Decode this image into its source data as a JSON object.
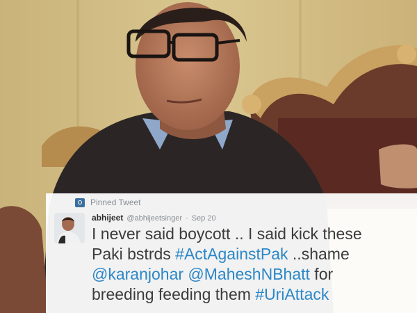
{
  "tweet": {
    "pinned_label": "Pinned Tweet",
    "pin_icon": "pin-icon",
    "display_name": "abhijeet",
    "handle": "@abhijeetsinger",
    "separator": "·",
    "date": "Sep 20",
    "lines": [
      [
        {
          "t": "I never said boycott .. I said kick these",
          "link": false
        }
      ],
      [
        {
          "t": "Paki bstrds ",
          "link": false
        },
        {
          "t": "#ActAgainstPak",
          "link": true
        },
        {
          "t": " ..shame",
          "link": false
        }
      ],
      [
        {
          "t": "@karanjohar",
          "link": true
        },
        {
          "t": " ",
          "link": false
        },
        {
          "t": "@MaheshNBhatt",
          "link": true
        },
        {
          "t": " for",
          "link": false
        }
      ],
      [
        {
          "t": "breeding feeding them ",
          "link": false
        },
        {
          "t": "#UriAttack",
          "link": true
        }
      ]
    ]
  },
  "colors": {
    "link": "#2b87c7",
    "text": "#3b3b3b",
    "muted": "#8a8f96"
  }
}
